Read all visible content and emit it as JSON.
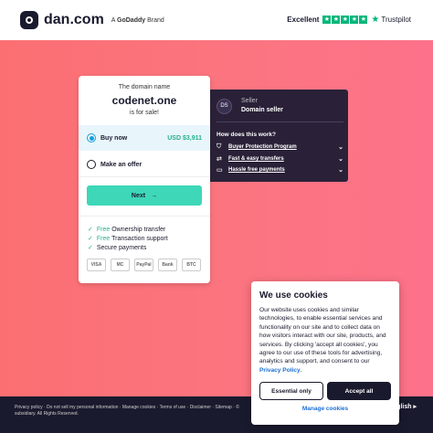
{
  "header": {
    "logo_text": "dan.com",
    "brand_prefix": "A ",
    "brand_name": "GoDaddy",
    "brand_suffix": " Brand",
    "trust_label": "Excellent",
    "trust_name": "Trustpilot",
    "trust_stars": 5
  },
  "colors": {
    "accent": "#3ed7b8",
    "price": "#26b08e",
    "hero_start": "#fb6f72",
    "hero_end": "#fd728a",
    "seller_bg": "#2a2138",
    "link": "#1b6fd1"
  },
  "card": {
    "intro": "The domain name",
    "domain": "codenet.one",
    "outro": "is for sale!",
    "buy_label": "Buy now",
    "buy_price": "USD $3,911",
    "offer_label": "Make an offer",
    "next_label": "Next",
    "features": [
      {
        "highlight": "Free",
        "text": " Ownership transfer"
      },
      {
        "highlight": "Free",
        "text": " Transaction support"
      },
      {
        "highlight": "",
        "text": "Secure payments"
      }
    ],
    "payments": [
      "VISA",
      "MC",
      "PayPal",
      "Bank",
      "BTC"
    ]
  },
  "seller": {
    "initials": "DS",
    "role": "Seller",
    "name": "Domain seller",
    "how_title": "How does this work?",
    "items": [
      {
        "icon": "buyer-protection-icon",
        "label": "Buyer Protection Program"
      },
      {
        "icon": "fast-transfer-icon",
        "label": "Fast & easy transfers"
      },
      {
        "icon": "payment-options-icon",
        "label": "Hassle free payments"
      }
    ]
  },
  "footer": {
    "links": "Privacy policy · Do not sell my personal information · Manage cookies · Terms of use · Disclaimer · Sitemap · ©",
    "copyright": "subsidiary. All Rights Reserved.",
    "language": "nglish ▸"
  },
  "cookie": {
    "title": "We use cookies",
    "text": "Our website uses cookies and similar technologies, to enable essential services and functionality on our site and to collect data on how visitors interact with our site, products, and services. By clicking 'accept all cookies', you agree to our use of these tools for advertising, analytics and support, and consent to our ",
    "policy_link": "Privacy Policy",
    "policy_end": ".",
    "essential_label": "Essential only",
    "accept_label": "Accept all",
    "manage_label": "Manage cookies"
  }
}
